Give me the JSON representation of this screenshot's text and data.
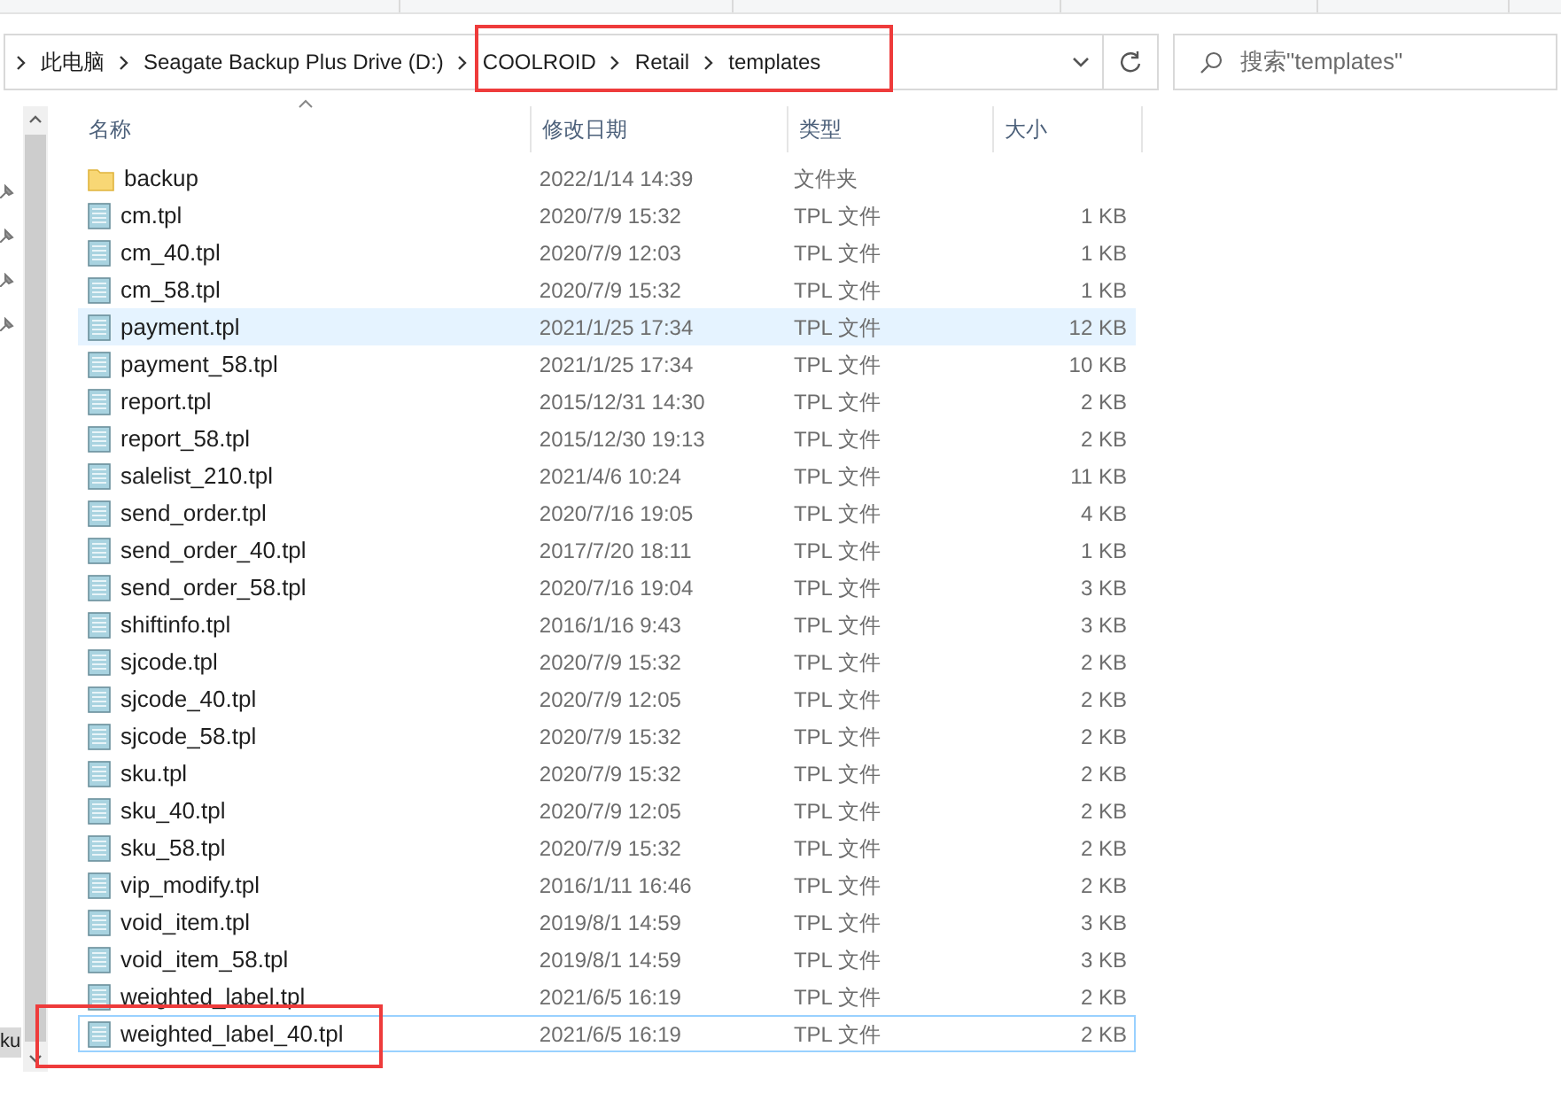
{
  "breadcrumb": {
    "items": [
      "此电脑",
      "Seagate Backup Plus Drive (D:)",
      "COOLROID",
      "Retail",
      "templates"
    ]
  },
  "search": {
    "placeholder": "搜索\"templates\""
  },
  "nav": {
    "items": [
      "ku"
    ]
  },
  "columns": [
    "名称",
    "修改日期",
    "类型",
    "大小"
  ],
  "rows": [
    {
      "kind": "folder",
      "name": "backup",
      "date": "2022/1/14 14:39",
      "type": "文件夹",
      "size": "",
      "selected": false,
      "focused": false
    },
    {
      "kind": "file",
      "name": "cm.tpl",
      "date": "2020/7/9 15:32",
      "type": "TPL 文件",
      "size": "1 KB",
      "selected": false,
      "focused": false
    },
    {
      "kind": "file",
      "name": "cm_40.tpl",
      "date": "2020/7/9 12:03",
      "type": "TPL 文件",
      "size": "1 KB",
      "selected": false,
      "focused": false
    },
    {
      "kind": "file",
      "name": "cm_58.tpl",
      "date": "2020/7/9 15:32",
      "type": "TPL 文件",
      "size": "1 KB",
      "selected": false,
      "focused": false
    },
    {
      "kind": "file",
      "name": "payment.tpl",
      "date": "2021/1/25 17:34",
      "type": "TPL 文件",
      "size": "12 KB",
      "selected": true,
      "focused": false
    },
    {
      "kind": "file",
      "name": "payment_58.tpl",
      "date": "2021/1/25 17:34",
      "type": "TPL 文件",
      "size": "10 KB",
      "selected": false,
      "focused": false
    },
    {
      "kind": "file",
      "name": "report.tpl",
      "date": "2015/12/31 14:30",
      "type": "TPL 文件",
      "size": "2 KB",
      "selected": false,
      "focused": false
    },
    {
      "kind": "file",
      "name": "report_58.tpl",
      "date": "2015/12/30 19:13",
      "type": "TPL 文件",
      "size": "2 KB",
      "selected": false,
      "focused": false
    },
    {
      "kind": "file",
      "name": "salelist_210.tpl",
      "date": "2021/4/6 10:24",
      "type": "TPL 文件",
      "size": "11 KB",
      "selected": false,
      "focused": false
    },
    {
      "kind": "file",
      "name": "send_order.tpl",
      "date": "2020/7/16 19:05",
      "type": "TPL 文件",
      "size": "4 KB",
      "selected": false,
      "focused": false
    },
    {
      "kind": "file",
      "name": "send_order_40.tpl",
      "date": "2017/7/20 18:11",
      "type": "TPL 文件",
      "size": "1 KB",
      "selected": false,
      "focused": false
    },
    {
      "kind": "file",
      "name": "send_order_58.tpl",
      "date": "2020/7/16 19:04",
      "type": "TPL 文件",
      "size": "3 KB",
      "selected": false,
      "focused": false
    },
    {
      "kind": "file",
      "name": "shiftinfo.tpl",
      "date": "2016/1/16 9:43",
      "type": "TPL 文件",
      "size": "3 KB",
      "selected": false,
      "focused": false
    },
    {
      "kind": "file",
      "name": "sjcode.tpl",
      "date": "2020/7/9 15:32",
      "type": "TPL 文件",
      "size": "2 KB",
      "selected": false,
      "focused": false
    },
    {
      "kind": "file",
      "name": "sjcode_40.tpl",
      "date": "2020/7/9 12:05",
      "type": "TPL 文件",
      "size": "2 KB",
      "selected": false,
      "focused": false
    },
    {
      "kind": "file",
      "name": "sjcode_58.tpl",
      "date": "2020/7/9 15:32",
      "type": "TPL 文件",
      "size": "2 KB",
      "selected": false,
      "focused": false
    },
    {
      "kind": "file",
      "name": "sku.tpl",
      "date": "2020/7/9 15:32",
      "type": "TPL 文件",
      "size": "2 KB",
      "selected": false,
      "focused": false
    },
    {
      "kind": "file",
      "name": "sku_40.tpl",
      "date": "2020/7/9 12:05",
      "type": "TPL 文件",
      "size": "2 KB",
      "selected": false,
      "focused": false
    },
    {
      "kind": "file",
      "name": "sku_58.tpl",
      "date": "2020/7/9 15:32",
      "type": "TPL 文件",
      "size": "2 KB",
      "selected": false,
      "focused": false
    },
    {
      "kind": "file",
      "name": "vip_modify.tpl",
      "date": "2016/1/11 16:46",
      "type": "TPL 文件",
      "size": "2 KB",
      "selected": false,
      "focused": false
    },
    {
      "kind": "file",
      "name": "void_item.tpl",
      "date": "2019/8/1 14:59",
      "type": "TPL 文件",
      "size": "3 KB",
      "selected": false,
      "focused": false
    },
    {
      "kind": "file",
      "name": "void_item_58.tpl",
      "date": "2019/8/1 14:59",
      "type": "TPL 文件",
      "size": "3 KB",
      "selected": false,
      "focused": false
    },
    {
      "kind": "file",
      "name": "weighted_label.tpl",
      "date": "2021/6/5 16:19",
      "type": "TPL 文件",
      "size": "2 KB",
      "selected": false,
      "focused": false
    },
    {
      "kind": "file",
      "name": "weighted_label_40.tpl",
      "date": "2021/6/5 16:19",
      "type": "TPL 文件",
      "size": "2 KB",
      "selected": false,
      "focused": true
    }
  ]
}
